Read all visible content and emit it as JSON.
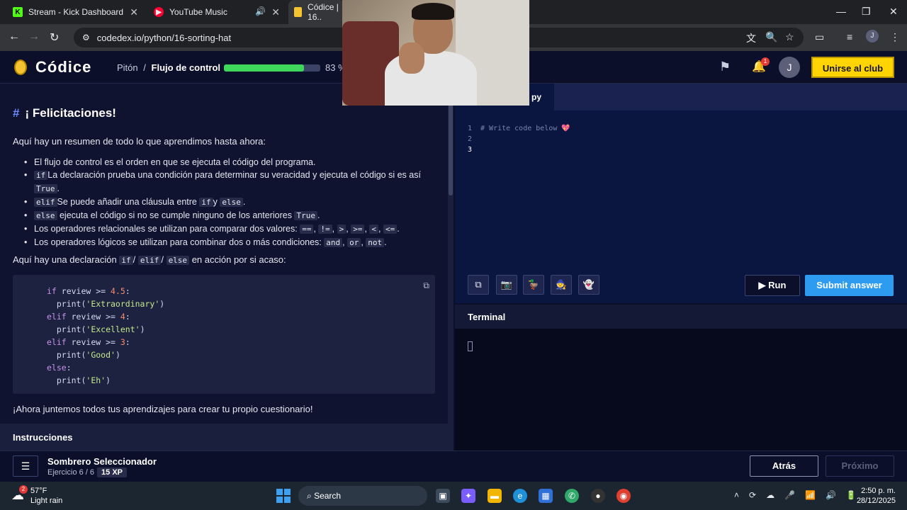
{
  "browser": {
    "tabs": [
      {
        "title": "Stream - Kick Dashboard",
        "favicon": "kick-icon",
        "color": "#53fc18"
      },
      {
        "title": "YouTube Music",
        "favicon": "youtube-music-icon",
        "color": "#ff0033"
      },
      {
        "title": "Códice | 16..",
        "favicon": "codex-icon",
        "color": "#f6c430"
      }
    ],
    "url": "codedex.io/python/16-sorting-hat",
    "profile_initial": "J"
  },
  "header": {
    "logo": "Códice",
    "breadcrumb_parent": "Pitón",
    "breadcrumb_sep": "/",
    "breadcrumb_current": "Flujo de control",
    "progress_percent": 83,
    "progress_label": "83 %",
    "notifications": "1",
    "avatar_initial": "J",
    "join_label": "Unirse al club"
  },
  "lesson": {
    "title": "¡ Felicitaciones!",
    "intro": "Aquí hay un resumen de todo lo que aprendimos hasta ahora:",
    "bullets": {
      "b1": "El flujo de control es el orden en que se ejecuta el código del programa.",
      "b2_code": "if",
      "b2_text": "La declaración prueba una condición para determinar su veracidad y ejecuta el código si es así",
      "b2_code2": "True",
      "b3_code": "elif",
      "b3_text": "Se puede añadir una cláusula entre",
      "b3_code2": "if",
      "b3_mid": "y",
      "b3_code3": "else",
      "b4_code": "else",
      "b4_text": "ejecuta el código si no se cumple ninguno de los anteriores",
      "b4_code2": "True",
      "b5_text": "Los operadores relacionales se utilizan para comparar dos valores:",
      "b5_ops": [
        "==",
        "!=",
        ">",
        ">=",
        "<",
        "<="
      ],
      "b6_text": "Los operadores lógicos se utilizan para combinar dos o más condiciones:",
      "b6_ops": [
        "and",
        "or",
        "not"
      ]
    },
    "statement_pre": "Aquí hay una declaración",
    "statement_codes": [
      "if",
      "elif",
      "else"
    ],
    "statement_post": "en acción por si acaso:",
    "code": {
      "l1_kw": "if",
      "l1_rest": " review >= ",
      "l1_num": "4.5",
      "l1_end": ":",
      "l2": "  print(",
      "l2_str": "'Extraordinary'",
      "l2_end": ")",
      "l3_kw": "elif",
      "l3_rest": " review >= ",
      "l3_num": "4",
      "l3_end": ":",
      "l4": "  print(",
      "l4_str": "'Excellent'",
      "l4_end": ")",
      "l5_kw": "elif",
      "l5_rest": " review >= ",
      "l5_num": "3",
      "l5_end": ":",
      "l6": "  print(",
      "l6_str": "'Good'",
      "l6_end": ")",
      "l7_kw": "else",
      "l7_end": ":",
      "l8": "  print(",
      "l8_str": "'Eh'",
      "l8_end": ")"
    },
    "closing": "¡Ahora juntemos todos tus aprendizajes para crear tu propio cuestionario!",
    "instructions_label": "Instrucciones"
  },
  "editor": {
    "tab_label": "py",
    "lines": [
      "# Write code below 💖",
      "",
      ""
    ],
    "line_numbers": [
      "1",
      "2",
      "3"
    ],
    "run_label": "Run",
    "submit_label": "Submit answer"
  },
  "terminal": {
    "label": "Terminal"
  },
  "footer": {
    "exercise_title": "Sombrero Seleccionador",
    "exercise_sub": "Ejercicio 6 / 6",
    "xp": "15 XP",
    "back_label": "Atrás",
    "next_label": "Próximo"
  },
  "taskbar": {
    "weather_badge": "2",
    "temp": "57°F",
    "condition": "Light rain",
    "search_label": "Search",
    "time": "2:50 p. m.",
    "date": "28/12/2025"
  }
}
